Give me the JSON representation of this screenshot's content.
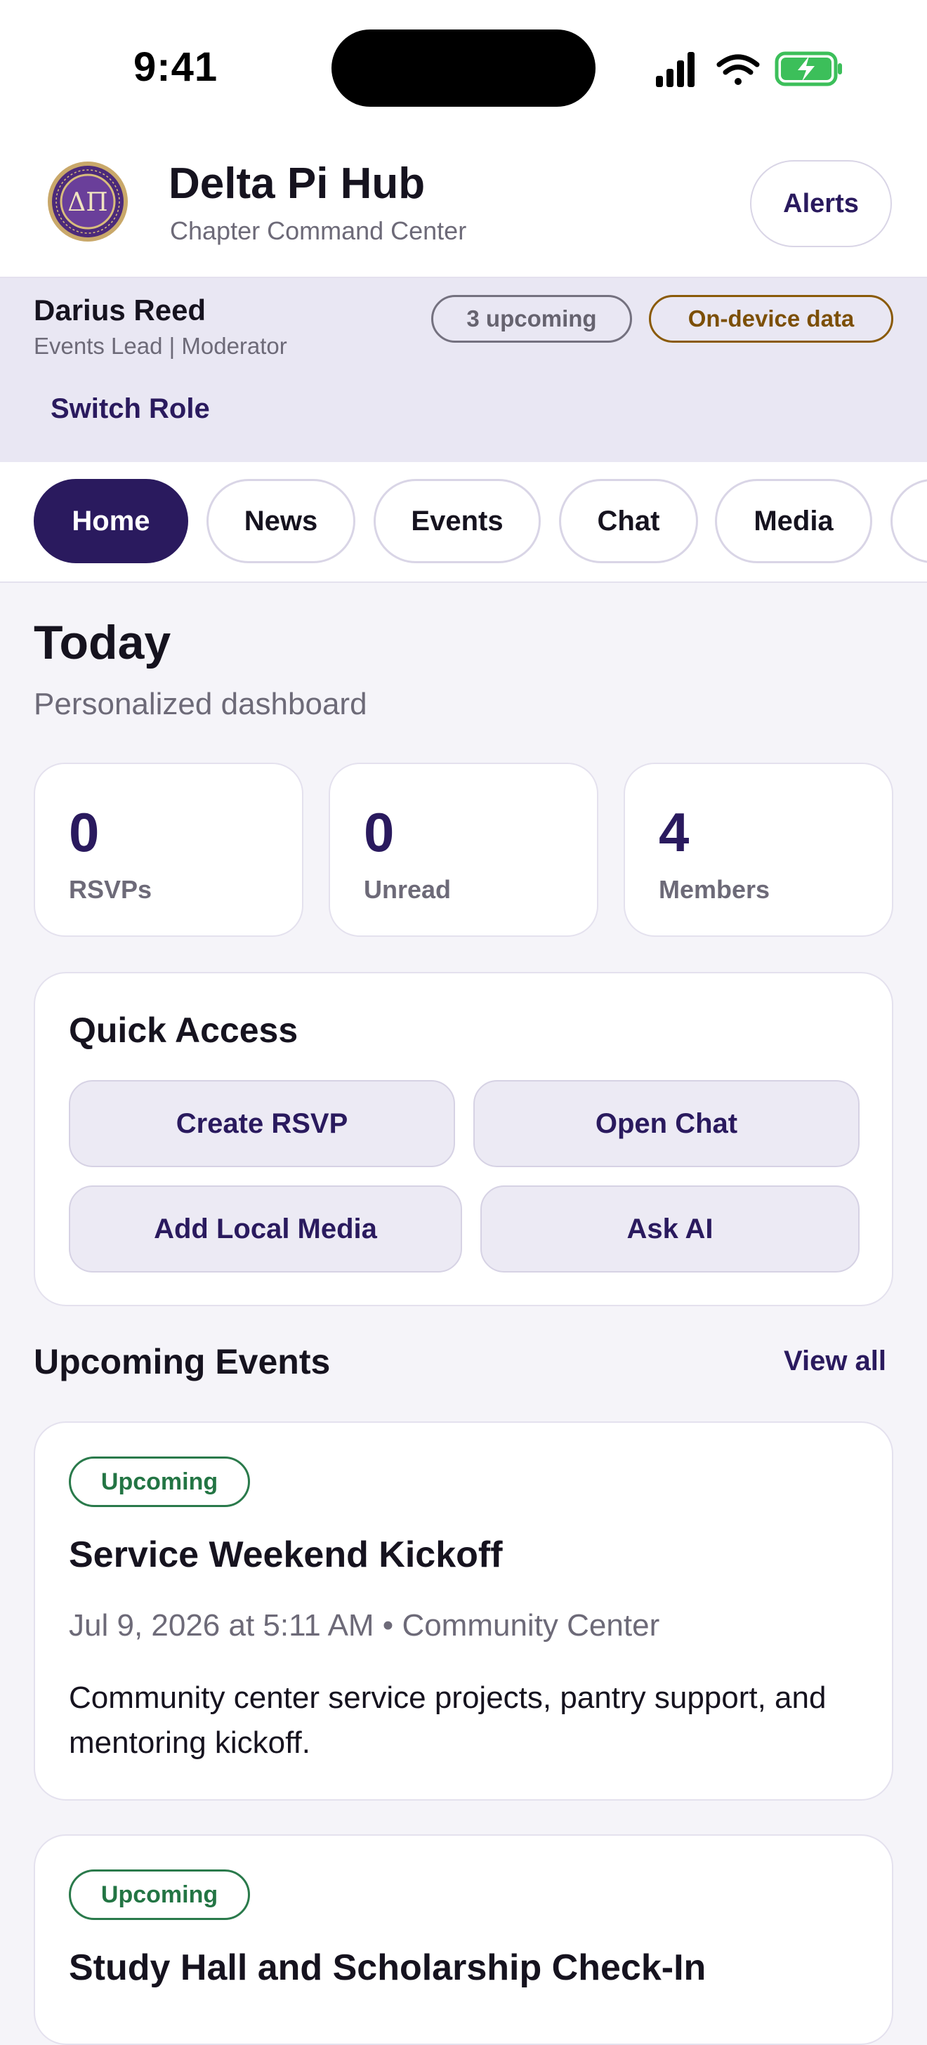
{
  "status_bar": {
    "time": "9:41"
  },
  "header": {
    "title": "Delta Pi Hub",
    "subtitle": "Chapter Command Center",
    "logo_letters": "ΔΠ",
    "alerts_label": "Alerts"
  },
  "profile": {
    "name": "Darius Reed",
    "role": "Events Lead | Moderator",
    "upcoming_badge": "3 upcoming",
    "data_badge": "On-device data",
    "switch_role": "Switch Role"
  },
  "tabs": [
    {
      "label": "Home",
      "active": true
    },
    {
      "label": "News"
    },
    {
      "label": "Events"
    },
    {
      "label": "Chat"
    },
    {
      "label": "Media"
    }
  ],
  "dashboard": {
    "title": "Today",
    "subtitle": "Personalized dashboard",
    "stats": [
      {
        "value": "0",
        "label": "RSVPs"
      },
      {
        "value": "0",
        "label": "Unread"
      },
      {
        "value": "4",
        "label": "Members"
      }
    ]
  },
  "quick_access": {
    "title": "Quick Access",
    "buttons": [
      "Create RSVP",
      "Open Chat",
      "Add Local Media",
      "Ask AI"
    ]
  },
  "upcoming_events": {
    "title": "Upcoming Events",
    "view_all": "View all",
    "events": [
      {
        "status": "Upcoming",
        "title": "Service Weekend Kickoff",
        "meta": "Jul 9, 2026 at 5:11 AM • Community Center",
        "description": "Community center service projects, pantry support, and mentoring kickoff."
      },
      {
        "status": "Upcoming",
        "title": "Study Hall and Scholarship Check-In"
      }
    ]
  },
  "colors": {
    "brand": "#2a1a5e",
    "accent_green": "#237544",
    "accent_gold": "#7c4f06",
    "background": "#f5f4f9"
  }
}
